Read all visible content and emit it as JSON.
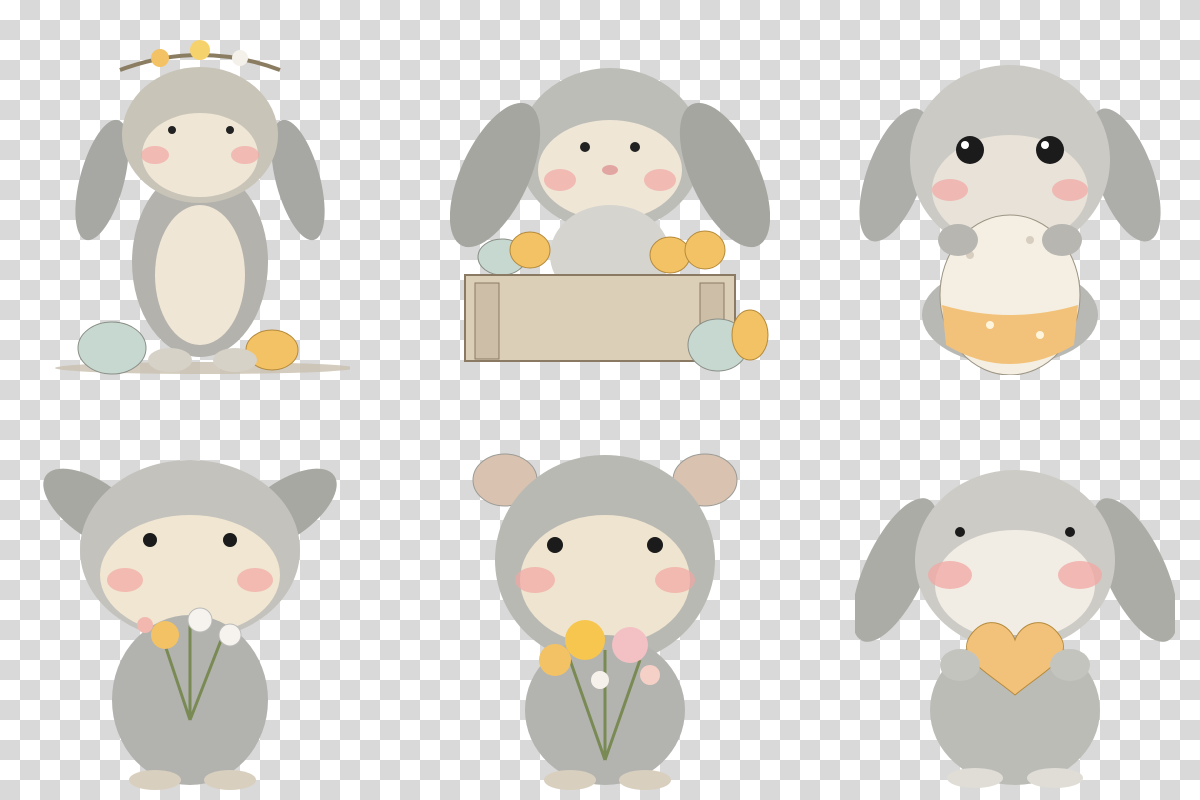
{
  "sheet": {
    "background": "transparency-checkerboard",
    "checker_colors": [
      "#ffffff",
      "#d9d9d9"
    ]
  },
  "bunnies": [
    {
      "id": "bunny-flower-crown",
      "pose": "standing",
      "props": [
        "flower-crown",
        "easter-eggs"
      ]
    },
    {
      "id": "bunny-wooden-crate",
      "pose": "sitting-in-crate",
      "props": [
        "wooden-crate",
        "easter-eggs"
      ]
    },
    {
      "id": "bunny-holding-egg",
      "pose": "holding-egg",
      "props": [
        "polka-dot-egg"
      ]
    },
    {
      "id": "bunny-white-bouquet",
      "pose": "holding-bouquet",
      "props": [
        "wildflower-bouquet"
      ]
    },
    {
      "id": "bunny-yellow-bouquet",
      "pose": "holding-bouquet",
      "props": [
        "yellow-pink-bouquet"
      ]
    },
    {
      "id": "bunny-holding-heart",
      "pose": "holding-heart",
      "props": [
        "heart-cookie"
      ]
    }
  ],
  "colors": {
    "fur_grey": "#a9aaa6",
    "fur_cream": "#efe6d6",
    "cheek": "#f2a7a3",
    "ear_inner": "#e8c3b4",
    "egg_yellow": "#f3c264",
    "egg_mint": "#c7d6cc",
    "crate_wood": "#d9cbb4"
  }
}
